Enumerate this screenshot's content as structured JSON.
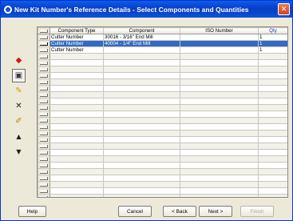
{
  "window": {
    "title": "New Kit Number's Reference Details - Select Components and Quantities",
    "close_glyph": "✕"
  },
  "toolbar": {
    "buttons": [
      {
        "icon": "insert-row-icon",
        "glyph": "◆"
      },
      {
        "icon": "edit-row-icon",
        "glyph": "▣"
      },
      {
        "icon": "add-component-icon",
        "glyph": "✎"
      },
      {
        "icon": "delete-icon",
        "glyph": "✕"
      },
      {
        "icon": "eraser-icon",
        "glyph": "✐"
      },
      {
        "icon": "move-up-icon",
        "glyph": "▲"
      },
      {
        "icon": "move-down-icon",
        "glyph": "▼"
      }
    ]
  },
  "grid": {
    "columns": [
      "Component Type",
      "Component",
      "ISO Number",
      "Qty"
    ],
    "rows": [
      {
        "type": "Cutter Number",
        "component": "30016 - 3/16\" End Mill",
        "iso": "",
        "qty": "1"
      },
      {
        "type": "Cutter Number",
        "component": "40004 - 1/4\" End Mill",
        "iso": "",
        "qty": "1",
        "selected": true
      },
      {
        "type": "Cutter Number",
        "component": "",
        "iso": "",
        "qty": "1"
      }
    ],
    "empty_rows": 23
  },
  "footer": {
    "help": "Help",
    "cancel": "Cancel",
    "back": "< Back",
    "next": "Next >",
    "finish": "Finish"
  },
  "colors": {
    "title_bar": "#0a4fd6",
    "selection": "#316ac5"
  }
}
